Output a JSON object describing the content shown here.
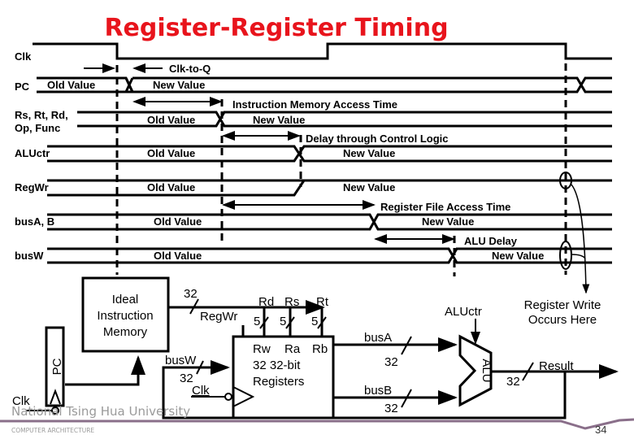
{
  "title": "Register-Register Timing",
  "colors": {
    "title": "#e8141c",
    "footer_bar": "#8a6f8a",
    "footer_text": "#9a9a9a"
  },
  "timing": {
    "signals": {
      "clk": "Clk",
      "pc": "PC",
      "inst": [
        "Rs, Rt, Rd,",
        "Op, Func"
      ],
      "aluctr": "ALUctr",
      "regwr": "RegWr",
      "busab": "busA, B",
      "busw": "busW"
    },
    "values": {
      "old": "Old Value",
      "new": "New Value"
    },
    "annotations": {
      "clk_to_q": "Clk-to-Q",
      "imem": "Instruction Memory Access Time",
      "control": "Delay through Control Logic",
      "regfile": "Register File Access Time",
      "alu": "ALU Delay"
    }
  },
  "datapath": {
    "imem": [
      "Ideal",
      "Instruction",
      "Memory"
    ],
    "pc": "PC",
    "clk": "Clk",
    "bus32": "32",
    "regwr": "RegWr",
    "rd": "Rd",
    "rs": "Rs",
    "rt": "Rt",
    "five": "5",
    "rw": "Rw",
    "ra": "Ra",
    "rb": "Rb",
    "regs": [
      "32 32-bit",
      "Registers"
    ],
    "busw": "busW",
    "busa": "busA",
    "busb": "busB",
    "aluctr": "ALUctr",
    "alu": "ALU",
    "result": "Result",
    "reg_write": [
      "Register Write",
      "Occurs Here"
    ]
  },
  "footer": {
    "university": "National Tsing Hua University",
    "course": "COMPUTER ARCHITECTURE",
    "page": "34"
  }
}
